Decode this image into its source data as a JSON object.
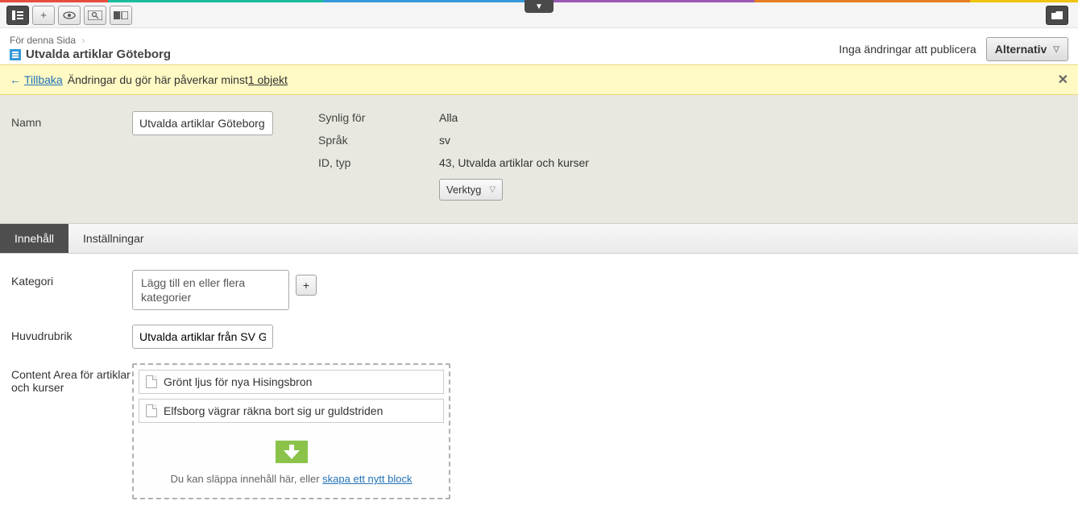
{
  "breadcrumb": {
    "parent": "För denna Sida",
    "title": "Utvalda artiklar Göteborg"
  },
  "publish": {
    "status": "Inga ändringar att publicera",
    "alternativ": "Alternativ"
  },
  "notice": {
    "back": "Tillbaka",
    "text_prefix": "Ändringar du gör här påverkar minst ",
    "affects": "1 objekt"
  },
  "header": {
    "name_label": "Namn",
    "name_value": "Utvalda artiklar Göteborg",
    "visible_label": "Synlig för",
    "visible_value": "Alla",
    "lang_label": "Språk",
    "lang_value": "sv",
    "id_label": "ID, typ",
    "id_value": "43, Utvalda artiklar och kurser",
    "tools": "Verktyg"
  },
  "tabs": {
    "content": "Innehåll",
    "settings": "Inställningar"
  },
  "form": {
    "category_label": "Kategori",
    "category_placeholder": "Lägg till en eller flera kategorier",
    "headline_label": "Huvudrubrik",
    "headline_value": "Utvalda artiklar från SV Göteborg",
    "contentarea_label": "Content Area för artiklar och kurser",
    "items": [
      "Grönt ljus för nya Hisingsbron",
      "Elfsborg vägrar räkna bort sig ur guldstriden"
    ],
    "drop_text_prefix": "Du kan släppa innehåll här, eller ",
    "drop_link": "skapa ett nytt block"
  }
}
